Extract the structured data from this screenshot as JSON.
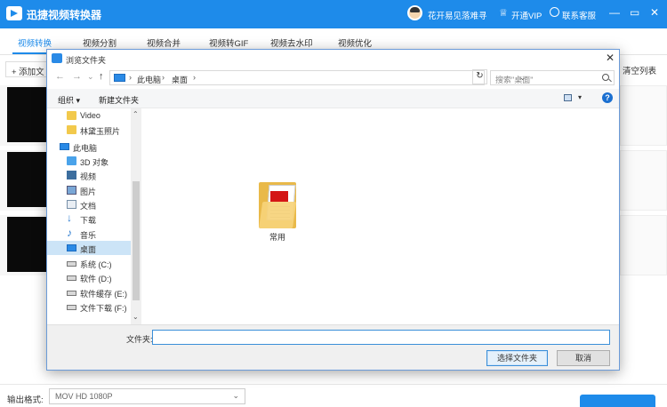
{
  "app": {
    "title": "迅捷视频转换器",
    "user_name": "花开易见落难寻",
    "vip_label": "开通VIP",
    "service_label": "联系客服",
    "min_glyph": "—",
    "restore_glyph": "▭",
    "close_glyph": "✕"
  },
  "tabs": [
    "视频转换",
    "视频分割",
    "视频合并",
    "视频转GIF",
    "视频去水印",
    "视频优化"
  ],
  "active_tab": 0,
  "toolbar": {
    "add_label": "+ 添加文",
    "clear_label": "清空列表"
  },
  "bottom": {
    "format_label": "输出格式:",
    "format_value": "MOV  HD 1080P"
  },
  "dialog": {
    "title": "浏览文件夹",
    "close_glyph": "✕",
    "nav": {
      "back": "←",
      "forward": "→",
      "recent": "⌄",
      "up": "↑"
    },
    "breadcrumbs": [
      "此电脑",
      "桌面"
    ],
    "search_placeholder": "搜索\"桌面\"",
    "refresh_glyph": "↻",
    "commands": {
      "organize": "组织 ▾",
      "new_folder": "新建文件夹"
    },
    "tree": [
      {
        "label": "Video",
        "icon": "folder-icon"
      },
      {
        "label": "林黛玉照片",
        "icon": "folder-icon"
      },
      {
        "label": "此电脑",
        "icon": "pc-icon",
        "root": true
      },
      {
        "label": "3D 对象",
        "icon": "cube-icon"
      },
      {
        "label": "视频",
        "icon": "video-icon"
      },
      {
        "label": "图片",
        "icon": "picture-icon"
      },
      {
        "label": "文档",
        "icon": "document-icon"
      },
      {
        "label": "下载",
        "icon": "download-icon"
      },
      {
        "label": "音乐",
        "icon": "music-icon"
      },
      {
        "label": "桌面",
        "icon": "desktop-icon",
        "selected": true
      },
      {
        "label": "系统 (C:)",
        "icon": "drive-icon"
      },
      {
        "label": "软件 (D:)",
        "icon": "drive-icon"
      },
      {
        "label": "软件缓存 (E:)",
        "icon": "drive-icon"
      },
      {
        "label": "文件下载 (F:)",
        "icon": "drive-icon"
      }
    ],
    "items": [
      {
        "label": "常用",
        "icon": "folder-icon"
      }
    ],
    "footer": {
      "folder_label": "文件夹:",
      "folder_value": "",
      "select_label": "选择文件夹",
      "cancel_label": "取消"
    }
  }
}
